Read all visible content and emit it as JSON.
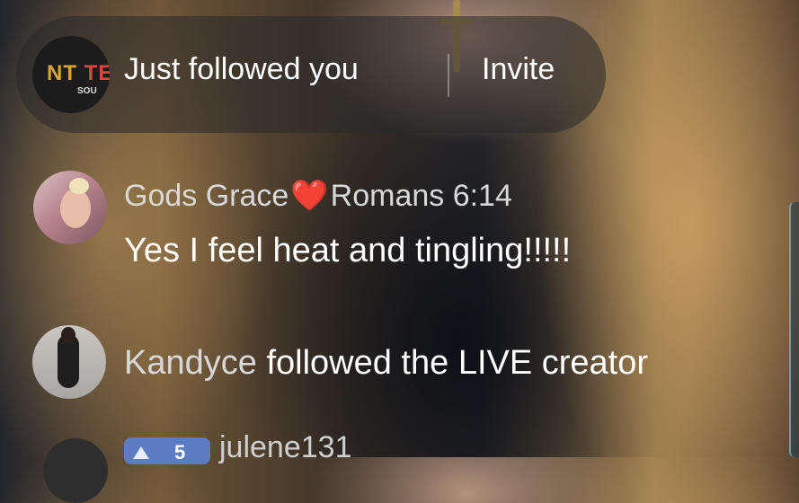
{
  "notification": {
    "avatar_text_main": "NT ",
    "avatar_text_accent": "TE",
    "avatar_subtext": "SOU",
    "message": "Just followed you",
    "invite_label": "Invite"
  },
  "comments": [
    {
      "name_start": "Gods Grace",
      "emoji": "❤️",
      "name_end": "Romans 6:14",
      "text": "Yes I feel heat and tingling!!!!!"
    }
  ],
  "follow_event": {
    "name": "Kandyce",
    "action": "followed the LIVE creator"
  },
  "partial_comment": {
    "badge_level": "5",
    "name": "julene131"
  },
  "colors": {
    "heart": "#ff2d3a",
    "badge": "#5d7bc3",
    "pill_bg": "rgba(40,40,42,0.55)"
  }
}
